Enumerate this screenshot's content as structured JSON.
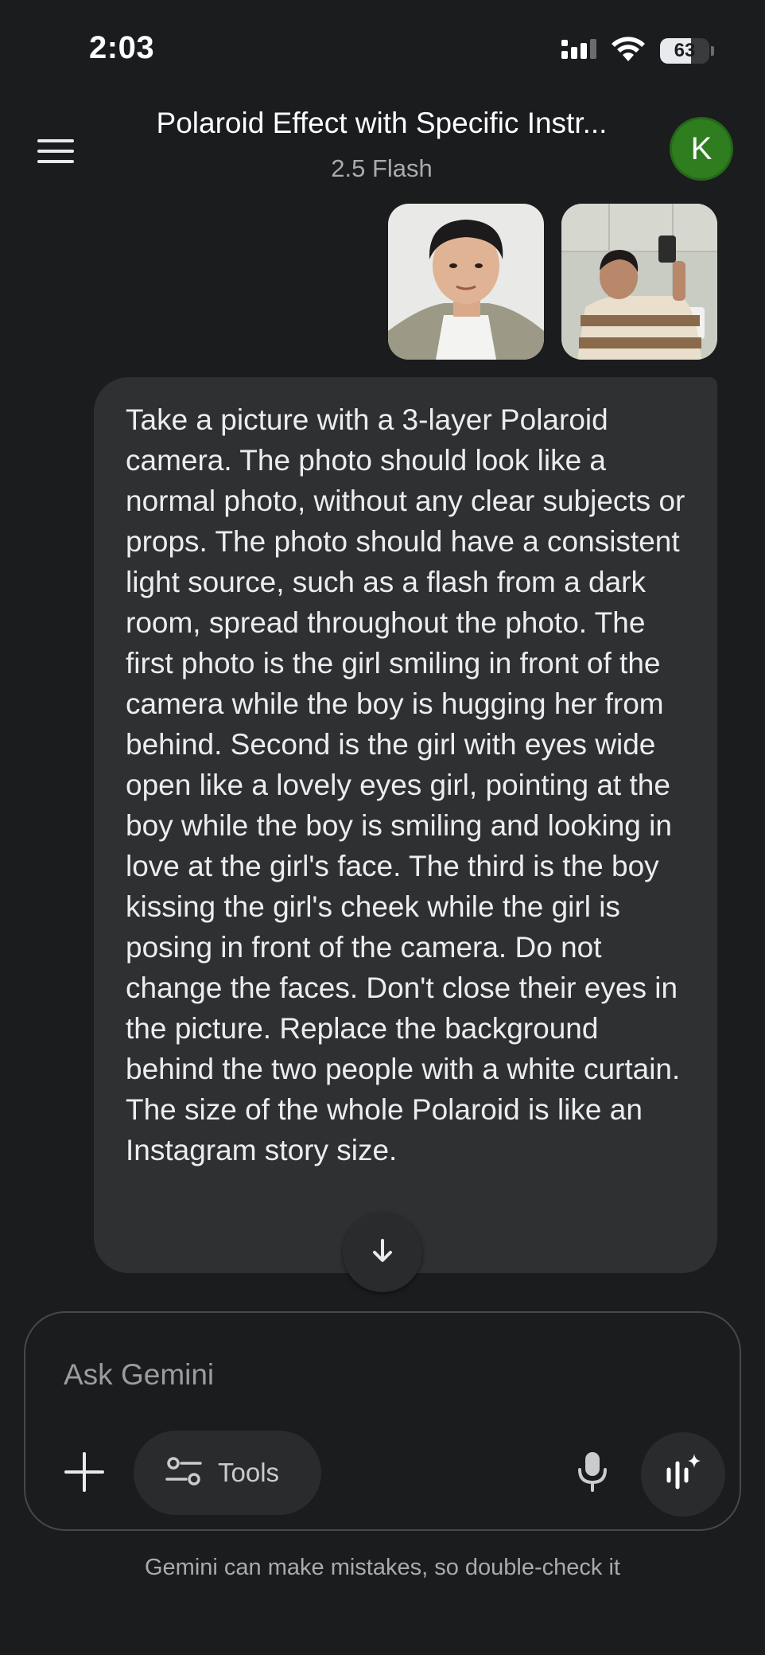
{
  "status_bar": {
    "time": "2:03",
    "battery_level": "63",
    "battery_fraction": 0.63
  },
  "header": {
    "title": "Polaroid Effect with Specific Instr...",
    "model": "2.5 Flash",
    "avatar_initial": "K",
    "avatar_color": "#2e7d1f"
  },
  "attachments": [
    {
      "kind": "image",
      "description": ""
    },
    {
      "kind": "image",
      "description": ""
    }
  ],
  "message": {
    "text": "Take a picture with a 3-layer Polaroid camera. The photo should look like a normal photo, without any clear subjects or props. The photo should have a consistent light source, such as a flash from a dark room, spread throughout the photo. The first photo is the girl smiling in front of the camera while the boy is hugging her from behind. Second is the girl with eyes wide open like a lovely eyes girl, pointing at the boy while the boy is smiling and looking in love at the girl's face. The third is the boy kissing the girl's cheek while the girl is posing in front of the camera. Do not change the faces. Don't close their eyes in the picture. Replace the background behind the two people with a white curtain. The size of the whole Polaroid is like an Instagram story size."
  },
  "input": {
    "placeholder": "Ask Gemini",
    "value": "",
    "tools_label": "Tools"
  },
  "footer": {
    "disclaimer": "Gemini can make mistakes, so double-check it"
  },
  "icons": [
    "menu-icon",
    "plus-icon",
    "tools-icon",
    "mic-icon",
    "live-icon",
    "arrow-down-icon",
    "signal-icon",
    "wifi-icon",
    "battery-icon"
  ]
}
